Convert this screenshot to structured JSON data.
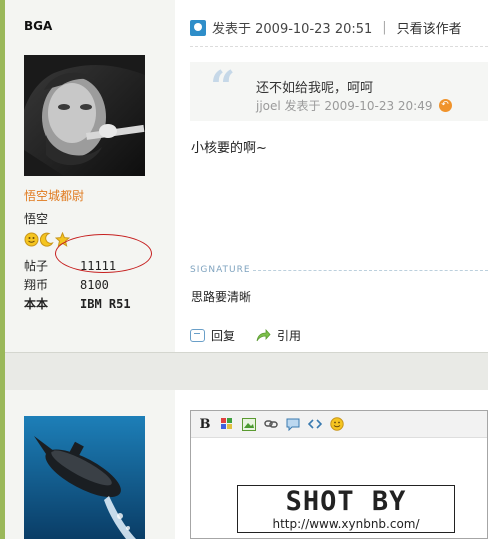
{
  "user": {
    "name": "BGA",
    "rank_title": "悟空城都尉",
    "group": "悟空",
    "stats": [
      {
        "label": "帖子",
        "value": "11111"
      },
      {
        "label": "翔币",
        "value": "8100"
      },
      {
        "label": "本本",
        "value": "IBM R51"
      }
    ]
  },
  "post": {
    "posted_at": "发表于 2009-10-23 20:51",
    "separator": "|",
    "only_author": "只看该作者",
    "quote": {
      "text": "还不如给我呢，呵呵",
      "meta": "jjoel 发表于 2009-10-23 20:49"
    },
    "body": "小核要的啊~",
    "signature_label": "SIGNATURE",
    "signature_text": "思路要清晰",
    "actions": {
      "reply": "回复",
      "quote": "引用"
    }
  },
  "editor": {
    "bold_label": "B"
  },
  "watermark": {
    "title": "SHOT BY",
    "url": "http://www.xynbnb.com/"
  },
  "colors": {
    "accent_green": "#9ab85a",
    "rank_orange": "#e07a1f",
    "annotation_red": "#c62020"
  }
}
